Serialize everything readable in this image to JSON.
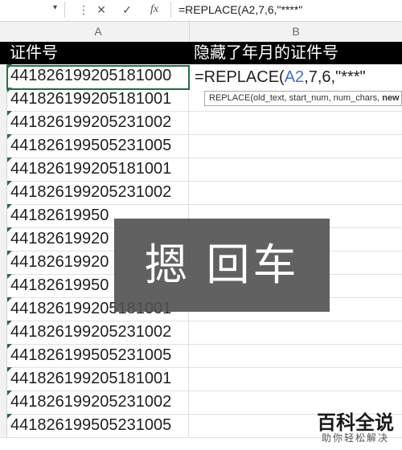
{
  "formula_bar": {
    "cancel_icon": "cancel-x-icon",
    "enter_icon": "enter-check-icon",
    "fx_label": "fx",
    "formula": "=REPLACE(A2,7,6,\"****\""
  },
  "columns": {
    "a": "A",
    "b": "B"
  },
  "headers": {
    "a": "证件号",
    "b": "隐藏了年月的证件号"
  },
  "edit_cell": {
    "prefix": "=REPLACE(",
    "ref": "A2",
    "suffix": ",7,6,\"***\""
  },
  "tooltip": {
    "args": "REPLACE(old_text, start_num, num_chars, ",
    "bold": "new"
  },
  "rows": [
    "441826199205181000",
    "441826199205181001",
    "441826199205231002",
    "441826199505231005",
    "441826199205181001",
    "441826199205231002",
    "44182619950",
    "44182619920",
    "44182619920",
    "44182619950",
    "441826199205181001",
    "441826199205231002",
    "441826199505231005",
    "441826199205181001",
    "441826199205231002",
    "441826199505231005"
  ],
  "overlay_text": "摁 回车",
  "watermark": {
    "title": "百科全说",
    "subtitle": "助你轻松解决"
  },
  "colors": {
    "accent": "#217346",
    "header_bg": "#000000",
    "ref_blue": "#3b6fd8"
  }
}
